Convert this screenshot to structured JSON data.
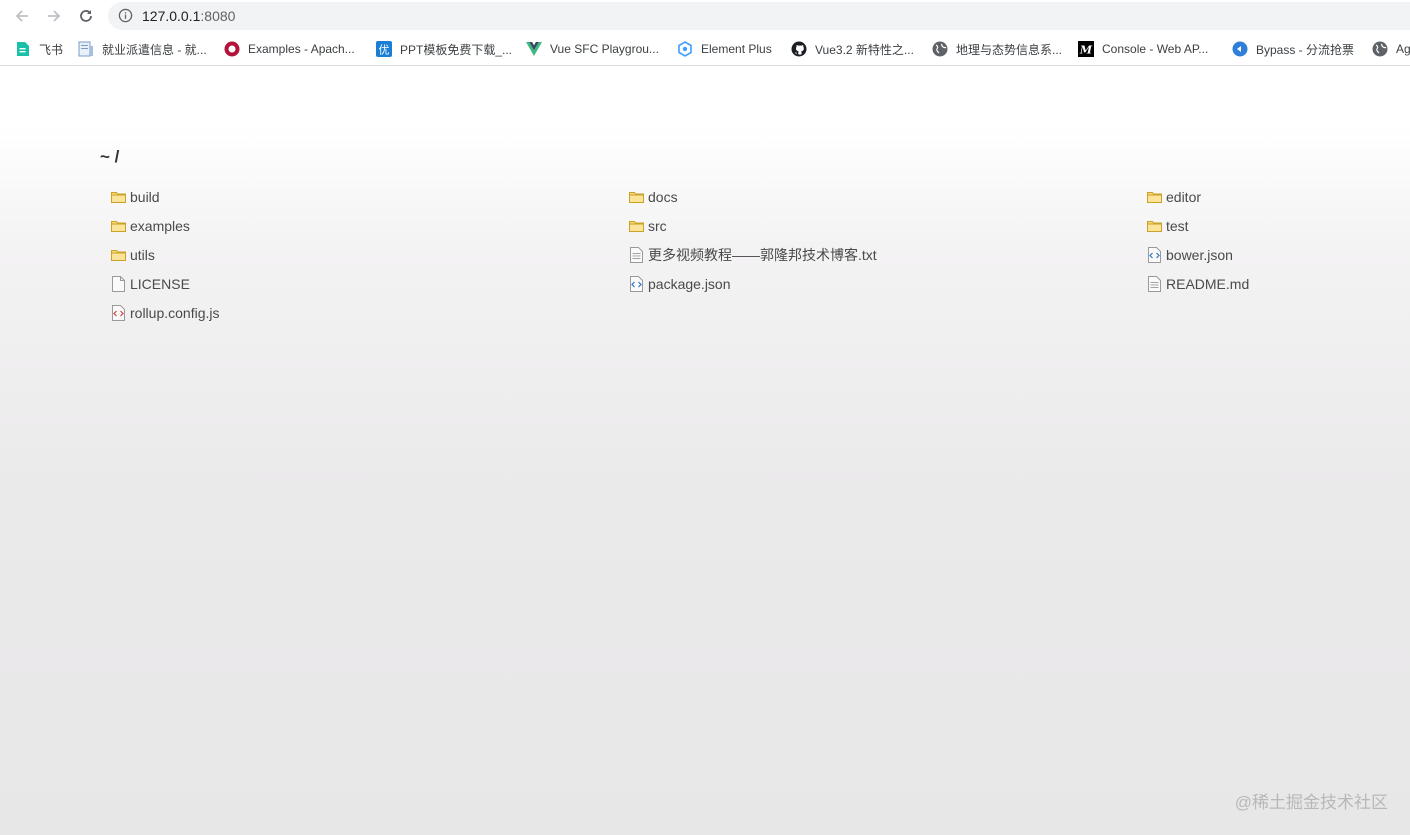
{
  "browser": {
    "url_host": "127.0.0.1",
    "url_port": ":8080"
  },
  "bookmarks": [
    {
      "label": "飞书",
      "icon": "feishu-doc-icon"
    },
    {
      "label": "就业派遣信息 - 就...",
      "icon": "doc-icon"
    },
    {
      "label": "Examples - Apach...",
      "icon": "apache-echarts-icon"
    },
    {
      "label": "PPT模板免费下载_...",
      "icon": "youppt-icon"
    },
    {
      "label": "Vue SFC Playgrou...",
      "icon": "vue-icon"
    },
    {
      "label": "Element Plus",
      "icon": "element-plus-icon"
    },
    {
      "label": "Vue3.2 新特性之...",
      "icon": "github-icon"
    },
    {
      "label": "地理与态势信息系...",
      "icon": "globe-icon"
    },
    {
      "label": "Console - Web AP...",
      "icon": "mdn-icon"
    },
    {
      "label": "Bypass - 分流抢票",
      "icon": "bypass-icon"
    },
    {
      "label": "Ag",
      "icon": "globe-icon"
    }
  ],
  "listing": {
    "path": "~ /",
    "files": [
      {
        "name": "build",
        "type": "folder"
      },
      {
        "name": "docs",
        "type": "folder"
      },
      {
        "name": "editor",
        "type": "folder"
      },
      {
        "name": "examples",
        "type": "folder"
      },
      {
        "name": "src",
        "type": "folder"
      },
      {
        "name": "test",
        "type": "folder"
      },
      {
        "name": "utils",
        "type": "folder"
      },
      {
        "name": "更多视频教程——郭隆邦技术博客.txt",
        "type": "text"
      },
      {
        "name": "bower.json",
        "type": "json"
      },
      {
        "name": "LICENSE",
        "type": "blank"
      },
      {
        "name": "package.json",
        "type": "json"
      },
      {
        "name": "README.md",
        "type": "text"
      },
      {
        "name": "rollup.config.js",
        "type": "js"
      }
    ]
  },
  "watermark": "@稀土掘金技术社区"
}
